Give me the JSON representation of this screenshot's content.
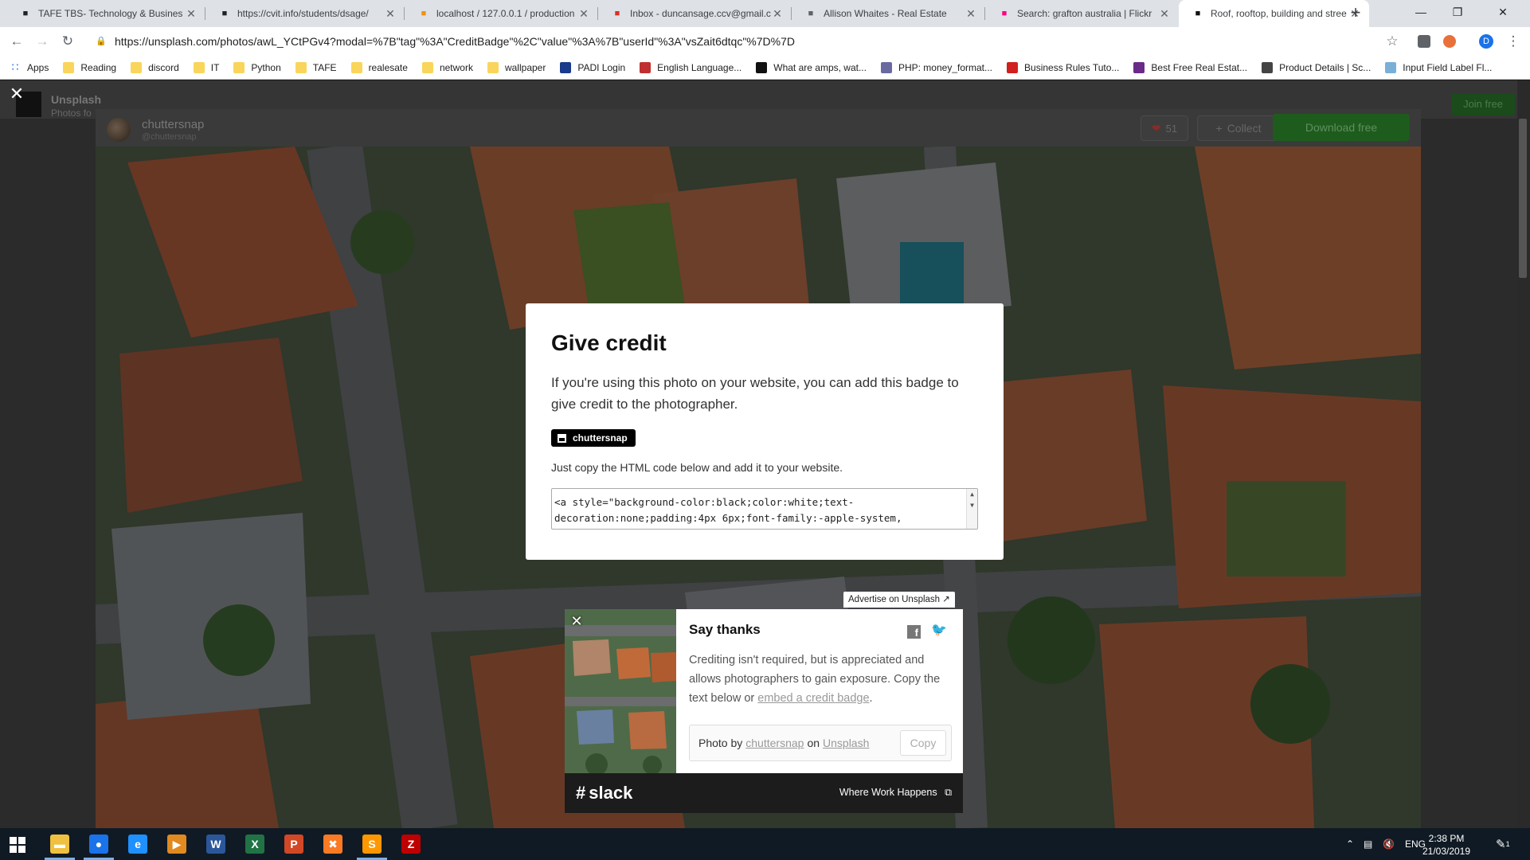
{
  "tabs": [
    {
      "title": "TAFE TBS- Technology & Busines",
      "icon": "graduation-cap-icon",
      "color": "#202124"
    },
    {
      "title": "https://cvit.info/students/dsage/",
      "icon": "graduation-cap-icon",
      "color": "#202124"
    },
    {
      "title": "localhost / 127.0.0.1 / production",
      "icon": "phpmyadmin-icon",
      "color": "#f29111"
    },
    {
      "title": "Inbox - duncansage.ccv@gmail.c",
      "icon": "gmail-icon",
      "color": "#d93025"
    },
    {
      "title": "Allison Whaites - Real Estate",
      "icon": "document-icon",
      "color": "#5f6368"
    },
    {
      "title": "Search: grafton australia | Flickr",
      "icon": "flickr-icon",
      "color": "#ff0084"
    },
    {
      "title": "Roof, rooftop, building and stree",
      "icon": "unsplash-icon",
      "color": "#111111"
    }
  ],
  "url": "https://unsplash.com/photos/awL_YCtPGv4?modal=%7B\"tag\"%3A\"CreditBadge\"%2C\"value\"%3A%7B\"userId\"%3A\"vsZait6dtqc\"%7D%7D",
  "profile_initial": "D",
  "bookmarks": [
    {
      "label": "Apps",
      "type": "apps"
    },
    {
      "label": "Reading",
      "type": "folder"
    },
    {
      "label": "discord",
      "type": "folder"
    },
    {
      "label": "IT",
      "type": "folder"
    },
    {
      "label": "Python",
      "type": "folder"
    },
    {
      "label": "TAFE",
      "type": "folder"
    },
    {
      "label": "realesate",
      "type": "folder"
    },
    {
      "label": "network",
      "type": "folder"
    },
    {
      "label": "wallpaper",
      "type": "folder"
    },
    {
      "label": "PADI Login",
      "type": "site",
      "color": "#1a3a8a"
    },
    {
      "label": "English Language...",
      "type": "site",
      "color": "#c03030"
    },
    {
      "label": "What are amps, wat...",
      "type": "site",
      "color": "#111111"
    },
    {
      "label": "PHP: money_format...",
      "type": "site",
      "color": "#6a6aa0"
    },
    {
      "label": "Business Rules Tuto...",
      "type": "site",
      "color": "#d02020"
    },
    {
      "label": "Best Free Real Estat...",
      "type": "site",
      "color": "#6a2a8a"
    },
    {
      "label": "Product Details | Sc...",
      "type": "site",
      "color": "#444444"
    },
    {
      "label": "Input Field Label Fl...",
      "type": "site",
      "color": "#7ab0d8"
    }
  ],
  "background_page": {
    "brand": "Unsplash",
    "brand_sub": "Photos fo",
    "join": "Join free"
  },
  "photo_header": {
    "photographer": "chuttersnap",
    "handle": "@chuttersnap",
    "likes": "51",
    "collect": "Collect",
    "download": "Download free"
  },
  "credit_modal": {
    "title": "Give credit",
    "description": "If you're using this photo on your website, you can add this badge to give credit to the photographer.",
    "badge_label": "chuttersnap",
    "instruction": "Just copy the HTML code below and add it to your website.",
    "code_line1": "<a style=\"background-color:black;color:white;text-",
    "code_line2": "decoration:none;padding:4px 6px;font-family:-apple-system,"
  },
  "ad_tag": "Advertise on Unsplash ↗",
  "say_thanks": {
    "title": "Say thanks",
    "body_part1": "Crediting isn't required, but is appreciated and allows photographers to gain exposure. Copy the text below or ",
    "body_link": "embed a credit badge",
    "body_part2": ".",
    "attr_prefix": "Photo by",
    "attr_user": "chuttersnap",
    "attr_on": "on",
    "attr_site": "Unsplash",
    "copy": "Copy"
  },
  "slack_ad": {
    "logo": "slack",
    "tagline": "Where Work Happens"
  },
  "taskbar": {
    "apps": [
      {
        "name": "file-explorer-icon",
        "color": "#f0c040",
        "glyph": "▬",
        "running": true
      },
      {
        "name": "chrome-icon",
        "color": "#1a73e8",
        "glyph": "●",
        "running": true
      },
      {
        "name": "internet-explorer-icon",
        "color": "#1e90ff",
        "glyph": "e",
        "running": false
      },
      {
        "name": "media-player-icon",
        "color": "#e08a20",
        "glyph": "▶",
        "running": false
      },
      {
        "name": "word-icon",
        "color": "#2b579a",
        "glyph": "W",
        "running": false
      },
      {
        "name": "excel-icon",
        "color": "#217346",
        "glyph": "X",
        "running": false
      },
      {
        "name": "powerpoint-icon",
        "color": "#d24726",
        "glyph": "P",
        "running": false
      },
      {
        "name": "xampp-icon",
        "color": "#fb7a24",
        "glyph": "✖",
        "running": false
      },
      {
        "name": "sublime-text-icon",
        "color": "#ff9800",
        "glyph": "S",
        "running": true
      },
      {
        "name": "filezilla-icon",
        "color": "#bf0000",
        "glyph": "Z",
        "running": false
      }
    ],
    "lang": "ENG",
    "time": "2:38 PM",
    "date": "21/03/2019",
    "notifications": "1"
  }
}
